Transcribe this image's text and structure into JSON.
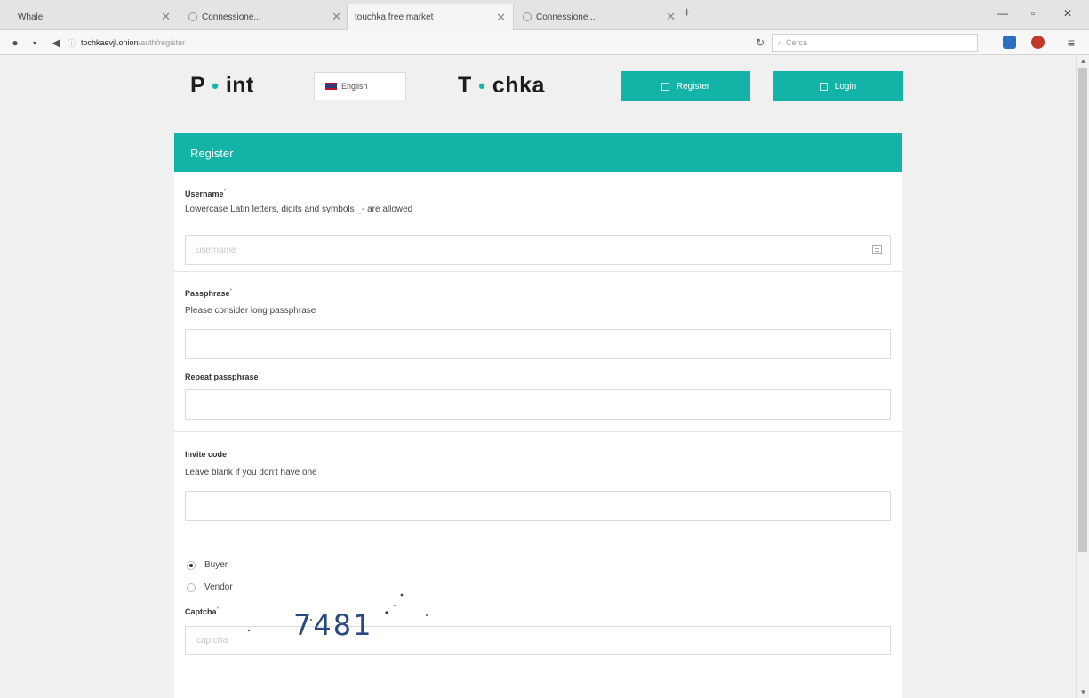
{
  "browser": {
    "tabs": [
      {
        "label": "Whale"
      },
      {
        "label": "Connessione..."
      },
      {
        "label": "touchka free market"
      },
      {
        "label": "Connessione..."
      }
    ],
    "url_host": "tochka",
    "url_domain": "evjl.onion",
    "url_path": "/auth/register",
    "search_placeholder": "Cerca"
  },
  "header": {
    "logo_left_a": "P",
    "logo_left_b": "int",
    "logo_right_a": "T",
    "logo_right_b": "chka",
    "language": "English",
    "register_label": "Register",
    "login_label": "Login"
  },
  "form": {
    "title": "Register",
    "username": {
      "label": "Username",
      "hint": "Lowercase Latin letters, digits and symbols _- are allowed",
      "placeholder": "username"
    },
    "passphrase": {
      "label": "Passphrase",
      "hint": "Please consider long passphrase"
    },
    "repeat": {
      "label": "Repeat passphrase"
    },
    "invite": {
      "label": "Invite code",
      "hint": "Leave blank if you don't have one"
    },
    "roles": [
      {
        "label": "Buyer",
        "checked": true
      },
      {
        "label": "Vendor",
        "checked": false
      }
    ],
    "captcha": {
      "label": "Captcha",
      "placeholder": "captcha",
      "text": "7481"
    }
  },
  "colors": {
    "accent": "#14b3a8"
  }
}
